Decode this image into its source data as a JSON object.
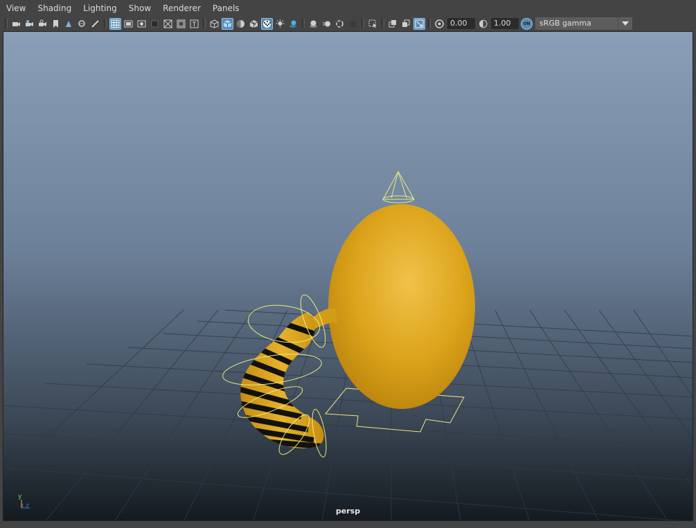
{
  "menu": [
    "View",
    "Shading",
    "Lighting",
    "Show",
    "Renderer",
    "Panels"
  ],
  "toolbar": {
    "exposure_value": "0.00",
    "gamma_value": "1.00",
    "color_space": "sRGB gamma",
    "color_management_badge": "ON"
  },
  "viewport": {
    "camera_label": "persp",
    "axis_labels": {
      "y": "y",
      "x": "x",
      "z": "z"
    },
    "colors": {
      "body": "#e0a81c",
      "stripe_dark": "#111111",
      "selection": "#ecec7a",
      "grid": "#2f3a45"
    }
  }
}
